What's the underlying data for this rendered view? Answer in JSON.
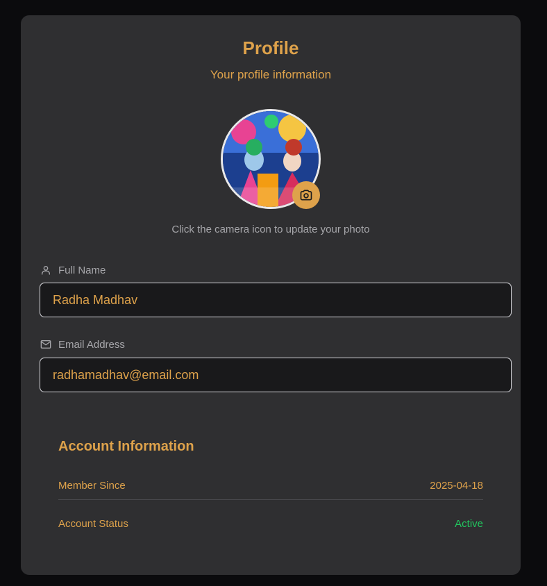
{
  "profile": {
    "title": "Profile",
    "subtitle": "Your profile information",
    "photo_hint": "Click the camera icon to update your photo"
  },
  "form": {
    "full_name": {
      "label": "Full Name",
      "value": "Radha Madhav",
      "icon": "user-icon"
    },
    "email": {
      "label": "Email Address",
      "value": "radhamadhav@email.com",
      "icon": "mail-icon"
    }
  },
  "account": {
    "title": "Account Information",
    "rows": [
      {
        "label": "Member Since",
        "value": "2025-04-18"
      },
      {
        "label": "Account Status",
        "value": "Active"
      }
    ]
  },
  "colors": {
    "accent": "#dea24b",
    "card_bg": "#2f2f31",
    "page_bg": "#0b0b0d",
    "status_active": "#22c55e"
  }
}
